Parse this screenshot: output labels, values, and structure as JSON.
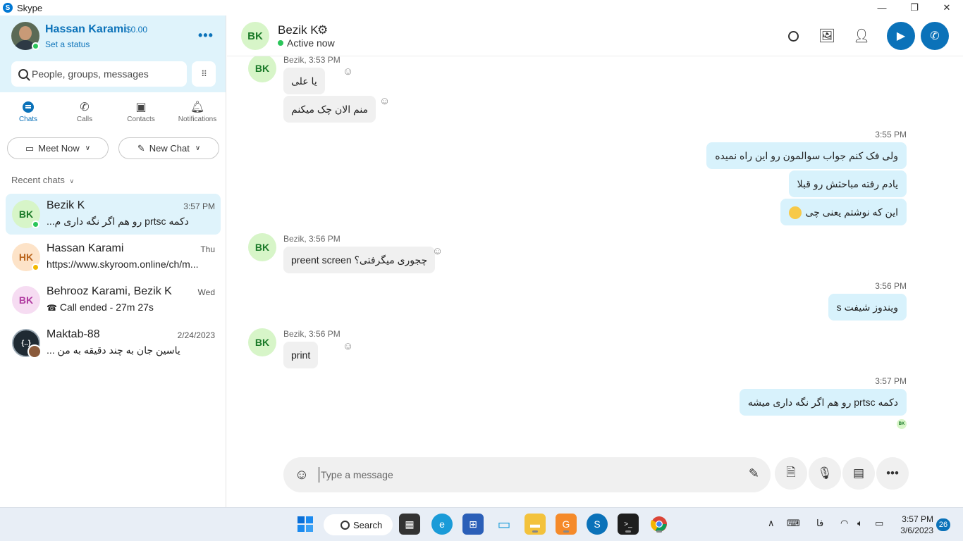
{
  "window": {
    "title": "Skype",
    "minimize": "—",
    "restore": "❐",
    "close": "✕"
  },
  "profile": {
    "name": "Hassan Karami",
    "credit": "$0.00",
    "status": "Set a status",
    "more": "•••"
  },
  "search": {
    "placeholder": "People, groups, messages"
  },
  "nav": [
    {
      "label": "Chats",
      "icon": "chat-icon"
    },
    {
      "label": "Calls",
      "icon": "phone-icon"
    },
    {
      "label": "Contacts",
      "icon": "contacts-icon"
    },
    {
      "label": "Notifications",
      "icon": "bell-icon"
    }
  ],
  "actions": {
    "meet_now": "Meet Now",
    "new_chat": "New Chat"
  },
  "recent_header": "Recent chats",
  "chats": [
    {
      "initials": "BK",
      "name": "Bezik K",
      "time": "3:57 PM",
      "preview": "دکمه prtsc رو هم اگر نگه داری م...",
      "avatar_bg": "#d7f5c8",
      "avatar_fg": "#1a7a28",
      "presence": "#2bc55a"
    },
    {
      "initials": "HK",
      "name": "Hassan Karami",
      "time": "Thu",
      "preview": "https://www.skyroom.online/ch/m...",
      "avatar_bg": "#fde3c8",
      "avatar_fg": "#b9631a",
      "presence": "#f2b800"
    },
    {
      "initials": "BK",
      "name": "Behrooz Karami, Bezik K",
      "time": "Wed",
      "preview": "Call ended - 27m 27s",
      "avatar_bg": "#f6dcf2",
      "avatar_fg": "#b03aa0"
    },
    {
      "initials": "{..}",
      "name": "Maktab-88",
      "time": "2/24/2023",
      "preview": "یاسین جان به چند دقیقه به من ...",
      "avatar_bg": "#1f2a33",
      "avatar_fg": "#ffffff"
    }
  ],
  "header": {
    "initials": "BK",
    "name": "Bezik K",
    "gear": "⚙",
    "status": "Active now"
  },
  "messages": {
    "in1_meta": "Bezik, 3:53 PM",
    "in1a": "یا علی",
    "in1b": "منم الان چک میکنم",
    "out1_time": "3:55 PM",
    "out1a": "ولی فک کنم جواب سوالمون رو این راه نمیده",
    "out1b": "یادم رفته مباحثش رو قبلا",
    "out1c": "این که نوشتم یعنی چی",
    "in2_meta": "Bezik, 3:56 PM",
    "in2": "چجوری میگرفتی؟ preent screen",
    "out2_time": "3:56 PM",
    "out2": "ویندوز شیفت s",
    "in3_meta": "Bezik, 3:56 PM",
    "in3": "print",
    "out3_time": "3:57 PM",
    "out3": "دکمه prtsc رو هم اگر نگه داری میشه",
    "receipt": "BK"
  },
  "compose": {
    "placeholder": "Type a message"
  },
  "taskbar": {
    "search": "Search",
    "lang": "فا",
    "time": "3:57 PM",
    "date": "3/6/2023",
    "badge": "26"
  },
  "colors": {
    "accent": "#0b72b9",
    "outgoing": "#d8f2fc",
    "incoming": "#f0f0f0",
    "sidebar_top": "#dff3fb"
  }
}
